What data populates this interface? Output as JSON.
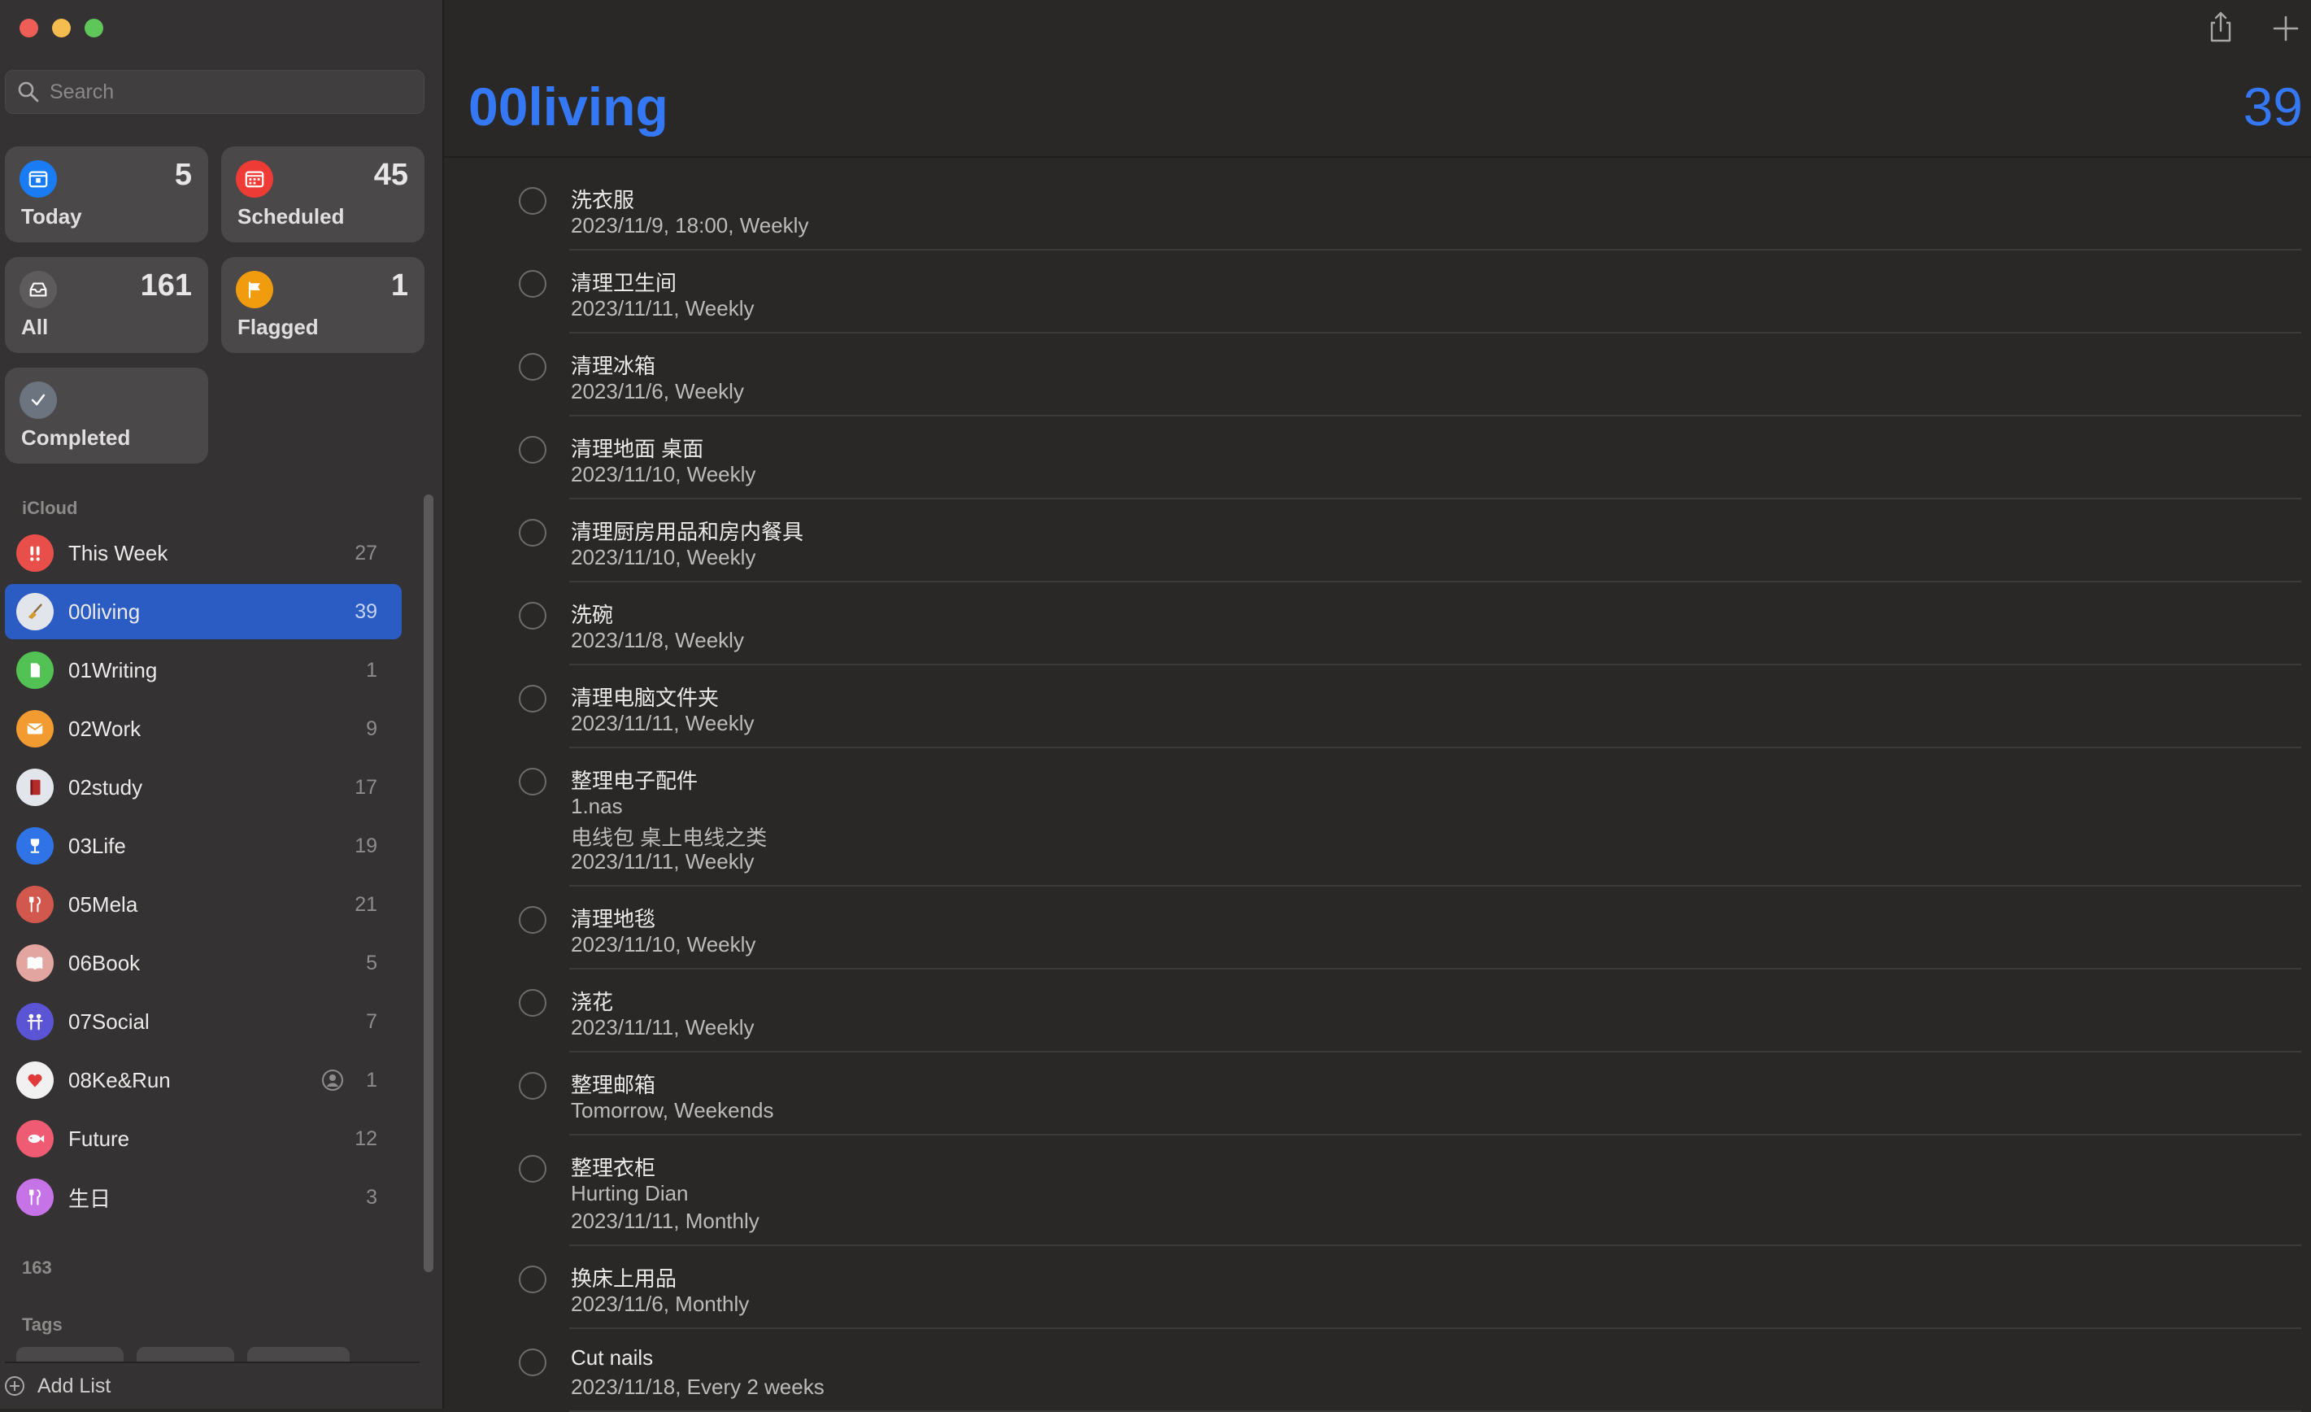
{
  "window": {
    "traffic_lights": [
      "close",
      "minimize",
      "zoom"
    ]
  },
  "search": {
    "placeholder": "Search"
  },
  "smart_lists": {
    "today": {
      "label": "Today",
      "count": "5",
      "color": "#1a7cf5",
      "icon": "calendar-today-icon"
    },
    "scheduled": {
      "label": "Scheduled",
      "count": "45",
      "color": "#ee3b36",
      "icon": "calendar-grid-icon"
    },
    "all": {
      "label": "All",
      "count": "161",
      "color": "#5d5b5b",
      "icon": "tray-icon"
    },
    "flagged": {
      "label": "Flagged",
      "count": "1",
      "color": "#f19b0e",
      "icon": "flag-icon"
    },
    "completed": {
      "label": "Completed",
      "color": "#6c7480",
      "icon": "checkmark-icon"
    }
  },
  "sections": {
    "icloud": "iCloud",
    "other_count": "163",
    "tags": "Tags"
  },
  "lists": [
    {
      "name": "This Week",
      "count": "27",
      "color": "#e94f4a",
      "icon": "exclamation-icon"
    },
    {
      "name": "00living",
      "count": "39",
      "color": "#e2e5ec",
      "icon": "broom-icon",
      "selected": true
    },
    {
      "name": "01Writing",
      "count": "1",
      "color": "#52c255",
      "icon": "document-icon"
    },
    {
      "name": "02Work",
      "count": "9",
      "color": "#f29b30",
      "icon": "envelope-icon"
    },
    {
      "name": "02study",
      "count": "17",
      "color": "#e2e5ec",
      "icon": "book-icon"
    },
    {
      "name": "03Life",
      "count": "19",
      "color": "#2f73e6",
      "icon": "wineglass-icon"
    },
    {
      "name": "05Mela",
      "count": "21",
      "color": "#d2584e",
      "icon": "fork-knife-icon"
    },
    {
      "name": "06Book",
      "count": "5",
      "color": "#e2a59f",
      "icon": "open-book-icon"
    },
    {
      "name": "07Social",
      "count": "7",
      "color": "#5b55d6",
      "icon": "people-icon"
    },
    {
      "name": "08Ke&Run",
      "count": "1",
      "color": "#f1f1f1",
      "icon": "heart-icon",
      "shared": true
    },
    {
      "name": "Future",
      "count": "12",
      "color": "#ef5b73",
      "icon": "fish-icon"
    },
    {
      "name": "生日",
      "count": "3",
      "color": "#c573e6",
      "icon": "utensils-icon"
    }
  ],
  "add_list": "Add List",
  "main": {
    "title": "00living",
    "total": "39",
    "tasks": [
      {
        "title": "洗衣服",
        "lines": [
          "2023/11/9, 18:00, Weekly"
        ]
      },
      {
        "title": "清理卫生间",
        "lines": [
          "2023/11/11, Weekly"
        ]
      },
      {
        "title": "清理冰箱",
        "lines": [
          "2023/11/6, Weekly"
        ]
      },
      {
        "title": "清理地面 桌面",
        "lines": [
          "2023/11/10, Weekly"
        ]
      },
      {
        "title": "清理厨房用品和房内餐具",
        "lines": [
          "2023/11/10, Weekly"
        ]
      },
      {
        "title": "洗碗",
        "lines": [
          "2023/11/8, Weekly"
        ]
      },
      {
        "title": "清理电脑文件夹",
        "lines": [
          "2023/11/11, Weekly"
        ]
      },
      {
        "title": "整理电子配件",
        "lines": [
          "1.nas",
          "电线包 桌上电线之类",
          "2023/11/11, Weekly"
        ]
      },
      {
        "title": "清理地毯",
        "lines": [
          "2023/11/10, Weekly"
        ]
      },
      {
        "title": "浇花",
        "lines": [
          "2023/11/11, Weekly"
        ]
      },
      {
        "title": "整理邮箱",
        "lines": [
          "Tomorrow, Weekends"
        ]
      },
      {
        "title": "整理衣柜",
        "lines": [
          "Hurting Dian",
          "2023/11/11, Monthly"
        ]
      },
      {
        "title": "换床上用品",
        "lines": [
          "2023/11/6, Monthly"
        ]
      },
      {
        "title": "Cut nails",
        "lines": [
          "2023/11/18, Every 2 weeks"
        ]
      }
    ]
  },
  "colors": {
    "accent": "#3478f6",
    "selection": "#2a5cc4"
  }
}
